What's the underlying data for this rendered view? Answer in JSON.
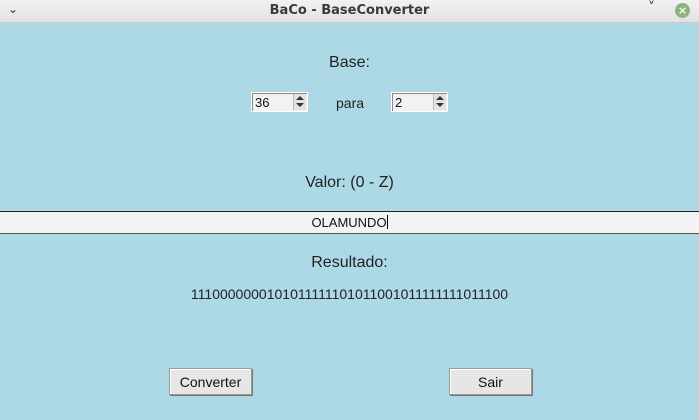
{
  "window": {
    "title": "BaCo - BaseConverter"
  },
  "labels": {
    "base": "Base:",
    "para": "para",
    "valor": "Valor: (0 - Z)",
    "resultado": "Resultado:"
  },
  "from_base": "36",
  "to_base": "2",
  "input_value": "OLAMUNDO",
  "result_value": "1110000000101011111101011001011111111011100",
  "buttons": {
    "convert": "Converter",
    "exit": "Sair"
  }
}
